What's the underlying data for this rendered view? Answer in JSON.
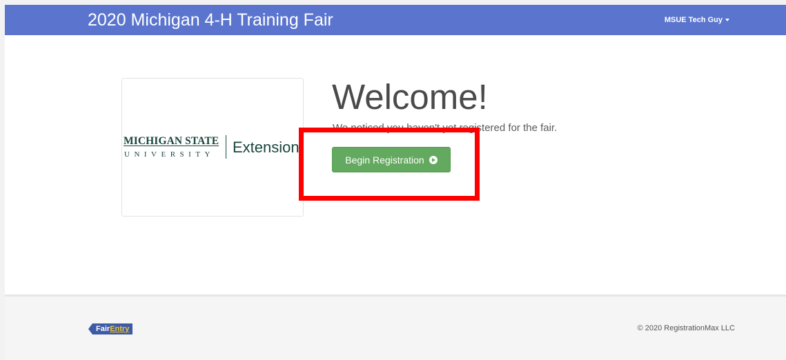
{
  "navbar": {
    "title": "2020 Michigan 4-H Training Fair",
    "user_menu": "MSUE Tech Guy"
  },
  "logo": {
    "line1": "MICHIGAN STATE",
    "line2": "UNIVERSITY",
    "extension": "Extension"
  },
  "main": {
    "heading": "Welcome!",
    "notice": "We noticed you haven't yet registered for the fair.",
    "begin_button": "Begin Registration"
  },
  "footer": {
    "logo_fair": "Fair",
    "logo_entry": "Entry",
    "copyright": "© 2020 RegistrationMax LLC"
  },
  "colors": {
    "navbar": "#5b75cf",
    "button": "#63a95f",
    "highlight": "#ff0000",
    "msu_green": "#18453b"
  },
  "icons": {
    "user_menu": "caret-down-icon",
    "begin_button": "circle-arrow-right-icon"
  }
}
